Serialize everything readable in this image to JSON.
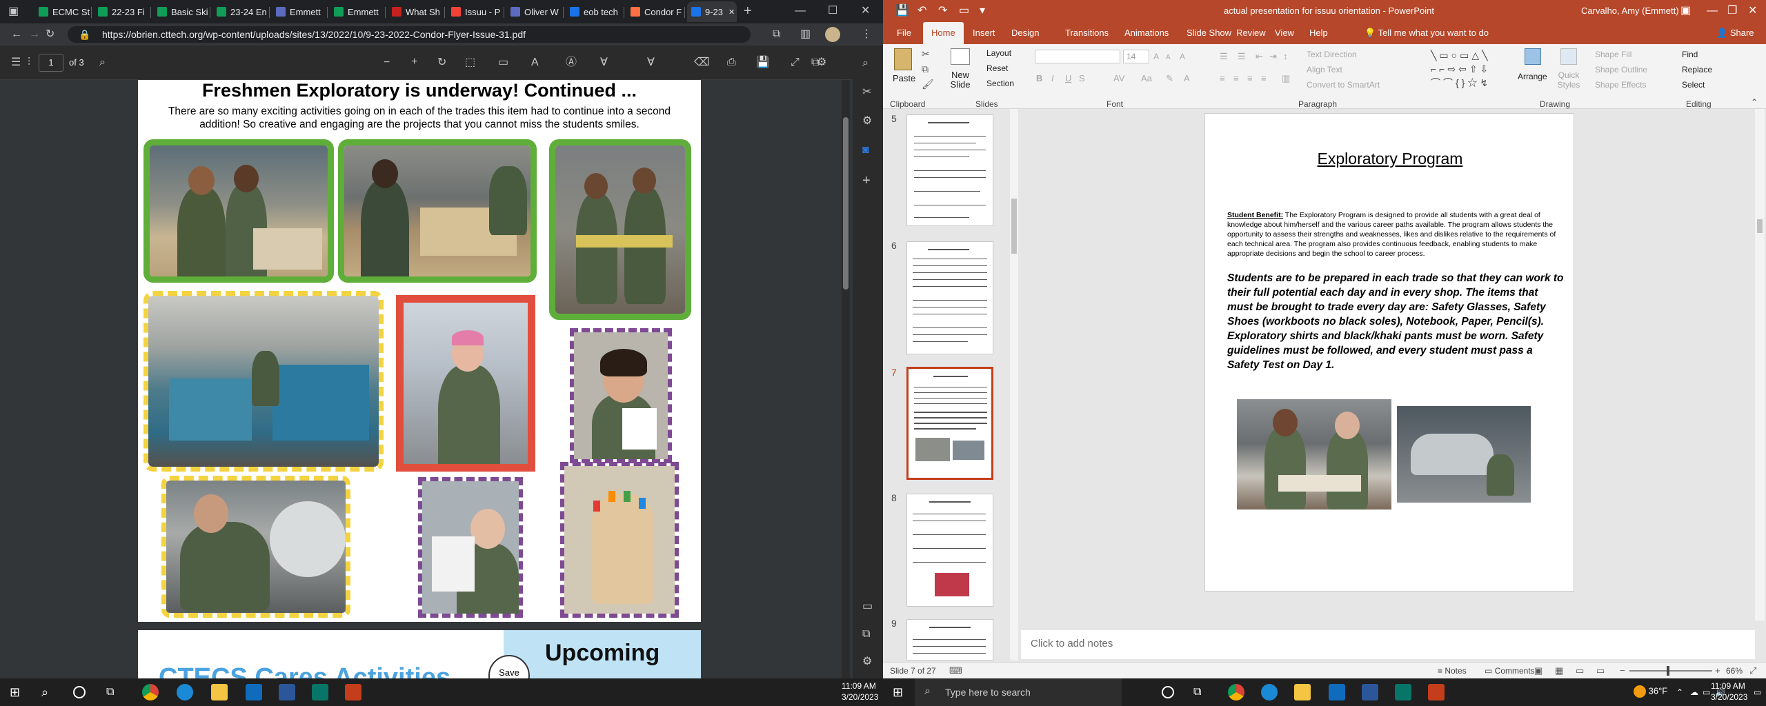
{
  "browser": {
    "tabs": [
      {
        "label": "ECMC St",
        "color": "#0f9d58"
      },
      {
        "label": "22-23 Fi",
        "color": "#0f9d58"
      },
      {
        "label": "Basic Ski",
        "color": "#0f9d58"
      },
      {
        "label": "23-24 En",
        "color": "#0f9d58"
      },
      {
        "label": "Emmett",
        "color": "#5c6bc0"
      },
      {
        "label": "Emmett",
        "color": "#0f9d58"
      },
      {
        "label": "What Sh",
        "color": "#c5221f"
      },
      {
        "label": "Issuu - P",
        "color": "#f44336"
      },
      {
        "label": "Oliver W",
        "color": "#5c6bc0"
      },
      {
        "label": "eob tech",
        "color": "#1a73e8"
      },
      {
        "label": "Condor F",
        "color": "#ff7043"
      },
      {
        "label": "9-23",
        "color": "#1a73e8"
      }
    ],
    "url": "https://obrien.cttech.org/wp-content/uploads/sites/13/2022/10/9-23-2022-Condor-Flyer-Issue-31.pdf",
    "pdf": {
      "page_number": "1",
      "page_total": "of 3",
      "heading": "Freshmen Exploratory is underway!  Continued ...",
      "intro": "There are so many exciting activities going on in each of the trades this item had to continue into a second addition! So creative and engaging are the projects that you cannot miss the students smiles.",
      "next_left": "CTECS Cares Activities",
      "next_right": "Upcoming",
      "stamp_text": "Save"
    }
  },
  "taskbar_left": {
    "time": "11:09 AM",
    "date": "3/20/2023"
  },
  "ppt": {
    "title": "actual presentation for issuu orientation  -  PowerPoint",
    "user": "Carvalho, Amy (Emmett)",
    "tabs": [
      "File",
      "Home",
      "Insert",
      "Design",
      "Transitions",
      "Animations",
      "Slide Show",
      "Review",
      "View",
      "Help"
    ],
    "tell_me": "Tell me what you want to do",
    "share": "Share",
    "ribbon": {
      "paste": "Paste",
      "new_slide": "New Slide",
      "layout": "Layout",
      "reset": "Reset",
      "section": "Section",
      "font_size": "14",
      "text_direction": "Text Direction",
      "align_text": "Align Text",
      "convert_smartart": "Convert to SmartArt",
      "arrange": "Arrange",
      "quick_styles": "Quick Styles",
      "shape_fill": "Shape Fill",
      "shape_outline": "Shape Outline",
      "shape_effects": "Shape Effects",
      "find": "Find",
      "replace": "Replace",
      "select": "Select",
      "groups": [
        "Clipboard",
        "Slides",
        "Font",
        "Paragraph",
        "Drawing",
        "Editing"
      ]
    },
    "thumb_numbers": [
      "5",
      "6",
      "7",
      "8",
      "9"
    ],
    "slide": {
      "title": "Exploratory Program",
      "benefit_label": "Student Benefit:",
      "benefit_text": " The Exploratory Program is designed to provide all students with a great deal of knowledge  about him/herself and the various career paths available. The program allows students the opportunity to  assess their strengths and weaknesses, likes and dislikes relative to the requirements of each technical area.  The program also provides continuous feedback, enabling students to make appropriate decisions and begin  the school to career process.",
      "bold_text": "Students are to be prepared in each trade so that they can work to their full potential each day and in every  shop. The items that must be brought to trade every day are: Safety Glasses, Safety Shoes (workboots no black soles),  Notebook, Paper, Pencil(s). Exploratory shirts and black/khaki pants must be worn. Safety guidelines must be followed, and every student must pass a Safety Test on Day 1."
    },
    "notes_placeholder": "Click to add notes",
    "status": {
      "slide_info": "Slide 7 of 27",
      "notes": "Notes",
      "comments": "Comments",
      "zoom": "66%"
    }
  },
  "taskbar_right": {
    "search": "Type here to search",
    "weather": "36°F",
    "time": "11:09 AM",
    "date": "3/20/2023"
  }
}
